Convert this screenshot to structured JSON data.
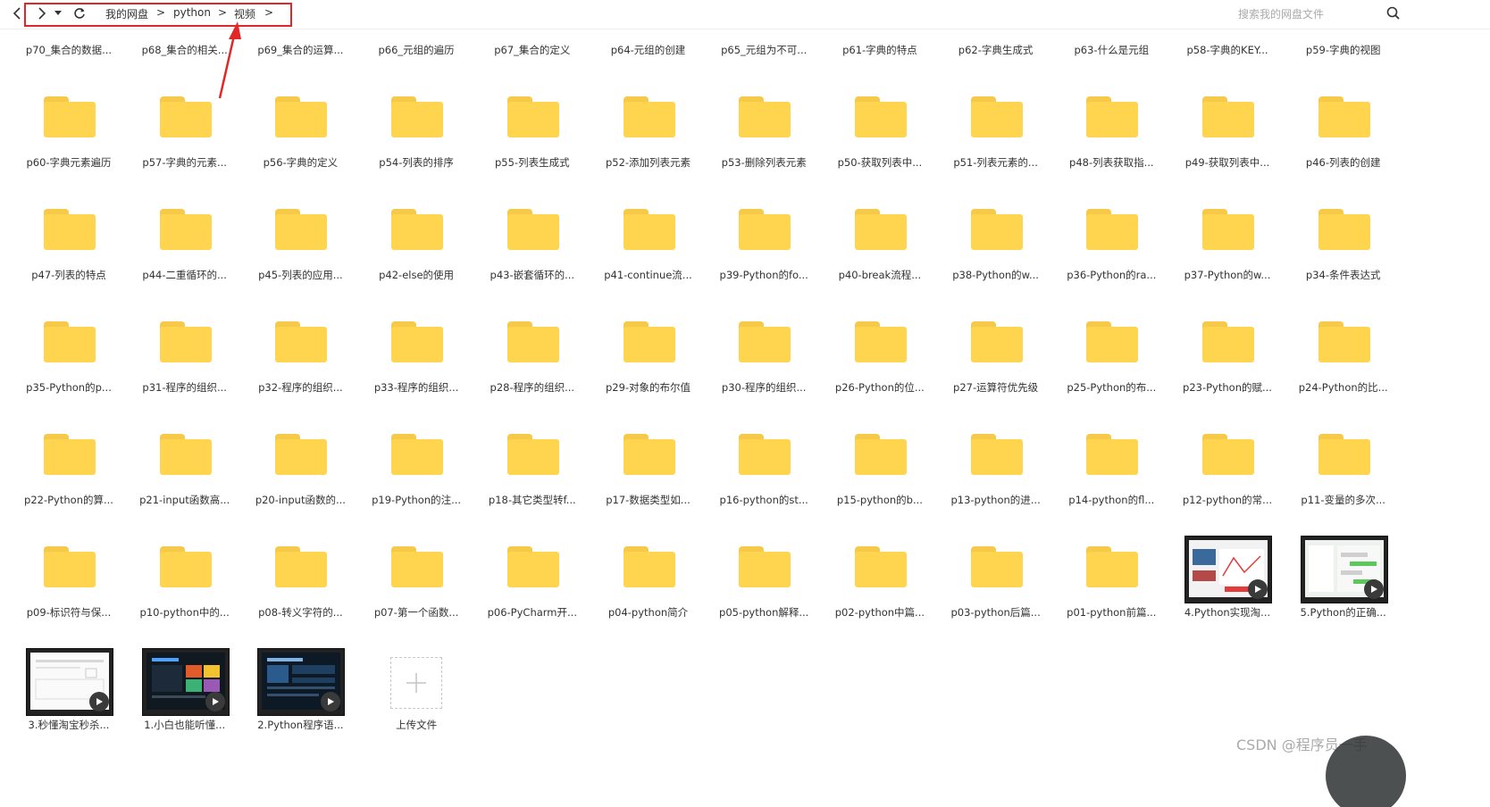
{
  "nav": {
    "back_icon": "chevron-left-icon",
    "forward_icon": "chevron-right-icon",
    "dropdown_icon": "caret-down-icon",
    "refresh_icon": "refresh-icon"
  },
  "breadcrumb": [
    {
      "label": "我的网盘"
    },
    {
      "label": "python"
    },
    {
      "label": "视频"
    }
  ],
  "breadcrumb_sep": ">",
  "search": {
    "placeholder": "搜索我的网盘文件"
  },
  "colors": {
    "folder": "#ffd54f",
    "folder_tab": "#f7c948",
    "highlight": "#e02828"
  },
  "rows": [
    [
      {
        "type": "folder",
        "label": "p70_集合的数据..."
      },
      {
        "type": "folder",
        "label": "p68_集合的相关..."
      },
      {
        "type": "folder",
        "label": "p69_集合的运算..."
      },
      {
        "type": "folder",
        "label": "p66_元组的遍历"
      },
      {
        "type": "folder",
        "label": "p67_集合的定义"
      },
      {
        "type": "folder",
        "label": "p64-元组的创建"
      },
      {
        "type": "folder",
        "label": "p65_元组为不可..."
      },
      {
        "type": "folder",
        "label": "p61-字典的特点"
      },
      {
        "type": "folder",
        "label": "p62-字典生成式"
      },
      {
        "type": "folder",
        "label": "p63-什么是元组"
      },
      {
        "type": "folder",
        "label": "p58-字典的KEY..."
      },
      {
        "type": "folder",
        "label": "p59-字典的视图"
      }
    ],
    [
      {
        "type": "folder",
        "label": "p60-字典元素遍历"
      },
      {
        "type": "folder",
        "label": "p57-字典的元素..."
      },
      {
        "type": "folder",
        "label": "p56-字典的定义"
      },
      {
        "type": "folder",
        "label": "p54-列表的排序"
      },
      {
        "type": "folder",
        "label": "p55-列表生成式"
      },
      {
        "type": "folder",
        "label": "p52-添加列表元素"
      },
      {
        "type": "folder",
        "label": "p53-删除列表元素"
      },
      {
        "type": "folder",
        "label": "p50-获取列表中..."
      },
      {
        "type": "folder",
        "label": "p51-列表元素的..."
      },
      {
        "type": "folder",
        "label": "p48-列表获取指..."
      },
      {
        "type": "folder",
        "label": "p49-获取列表中..."
      },
      {
        "type": "folder",
        "label": "p46-列表的创建"
      }
    ],
    [
      {
        "type": "folder",
        "label": "p47-列表的特点"
      },
      {
        "type": "folder",
        "label": "p44-二重循环的..."
      },
      {
        "type": "folder",
        "label": "p45-列表的应用..."
      },
      {
        "type": "folder",
        "label": "p42-else的使用"
      },
      {
        "type": "folder",
        "label": "p43-嵌套循环的..."
      },
      {
        "type": "folder",
        "label": "p41-continue流..."
      },
      {
        "type": "folder",
        "label": "p39-Python的fo..."
      },
      {
        "type": "folder",
        "label": "p40-break流程..."
      },
      {
        "type": "folder",
        "label": "p38-Python的w..."
      },
      {
        "type": "folder",
        "label": "p36-Python的ra..."
      },
      {
        "type": "folder",
        "label": "p37-Python的w..."
      },
      {
        "type": "folder",
        "label": "p34-条件表达式"
      }
    ],
    [
      {
        "type": "folder",
        "label": "p35-Python的p..."
      },
      {
        "type": "folder",
        "label": "p31-程序的组织..."
      },
      {
        "type": "folder",
        "label": "p32-程序的组织..."
      },
      {
        "type": "folder",
        "label": "p33-程序的组织..."
      },
      {
        "type": "folder",
        "label": "p28-程序的组织..."
      },
      {
        "type": "folder",
        "label": "p29-对象的布尔值"
      },
      {
        "type": "folder",
        "label": "p30-程序的组织..."
      },
      {
        "type": "folder",
        "label": "p26-Python的位..."
      },
      {
        "type": "folder",
        "label": "p27-运算符优先级"
      },
      {
        "type": "folder",
        "label": "p25-Python的布..."
      },
      {
        "type": "folder",
        "label": "p23-Python的赋..."
      },
      {
        "type": "folder",
        "label": "p24-Python的比..."
      }
    ],
    [
      {
        "type": "folder",
        "label": "p22-Python的算..."
      },
      {
        "type": "folder",
        "label": "p21-input函数高..."
      },
      {
        "type": "folder",
        "label": "p20-input函数的..."
      },
      {
        "type": "folder",
        "label": "p19-Python的注..."
      },
      {
        "type": "folder",
        "label": "p18-其它类型转f..."
      },
      {
        "type": "folder",
        "label": "p17-数据类型如..."
      },
      {
        "type": "folder",
        "label": "p16-python的st..."
      },
      {
        "type": "folder",
        "label": "p15-python的b..."
      },
      {
        "type": "folder",
        "label": "p13-python的进..."
      },
      {
        "type": "folder",
        "label": "p14-python的fl..."
      },
      {
        "type": "folder",
        "label": "p12-python的常..."
      },
      {
        "type": "folder",
        "label": "p11-变量的多次..."
      }
    ],
    [
      {
        "type": "folder",
        "label": "p09-标识符与保..."
      },
      {
        "type": "folder",
        "label": "p10-python中的..."
      },
      {
        "type": "folder",
        "label": "p08-转义字符的..."
      },
      {
        "type": "folder",
        "label": "p07-第一个函数..."
      },
      {
        "type": "folder",
        "label": "p06-PyCharm开..."
      },
      {
        "type": "folder",
        "label": "p04-python简介"
      },
      {
        "type": "folder",
        "label": "p05-python解释..."
      },
      {
        "type": "folder",
        "label": "p02-python中篇..."
      },
      {
        "type": "folder",
        "label": "p03-python后篇..."
      },
      {
        "type": "folder",
        "label": "p01-python前篇..."
      },
      {
        "type": "video",
        "label": "4.Python实现淘...",
        "theme": "light-red"
      },
      {
        "type": "video",
        "label": "5.Python的正确...",
        "theme": "light-chat"
      }
    ],
    [
      {
        "type": "video",
        "label": "3.秒懂淘宝秒杀...",
        "theme": "white"
      },
      {
        "type": "video",
        "label": "1.小白也能听懂...",
        "theme": "dark-colorful"
      },
      {
        "type": "video",
        "label": "2.Python程序语...",
        "theme": "dark-blue"
      },
      {
        "type": "upload",
        "label": "上传文件"
      }
    ]
  ],
  "watermark": "CSDN @程序员一手"
}
